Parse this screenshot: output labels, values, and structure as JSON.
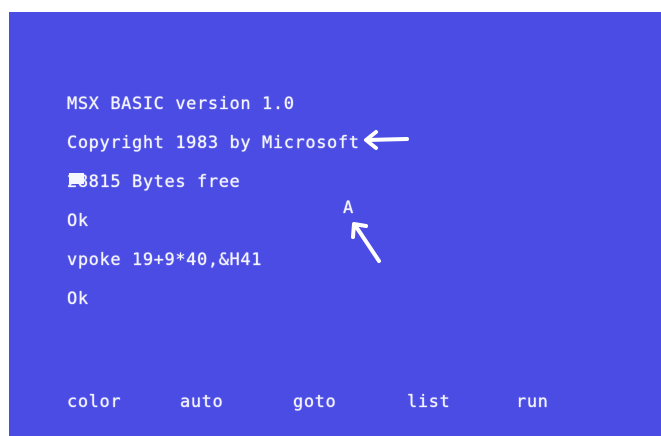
{
  "screen": {
    "lines": [
      "MSX BASIC version 1.0",
      "Copyright 1983 by Microsoft",
      "28815 Bytes free",
      "Ok",
      "vpoke 19+9*40,&H41",
      "Ok"
    ],
    "poked_char": "A",
    "function_keys": [
      "color",
      "auto",
      "goto",
      "list",
      "run"
    ]
  },
  "colors": {
    "background": "#4b4ce4",
    "foreground": "#f4f4ff",
    "annotation": "#ffffff"
  },
  "annotations": {
    "arrow_1_icon": "arrow-left-icon",
    "arrow_2_icon": "arrow-up-left-icon"
  }
}
